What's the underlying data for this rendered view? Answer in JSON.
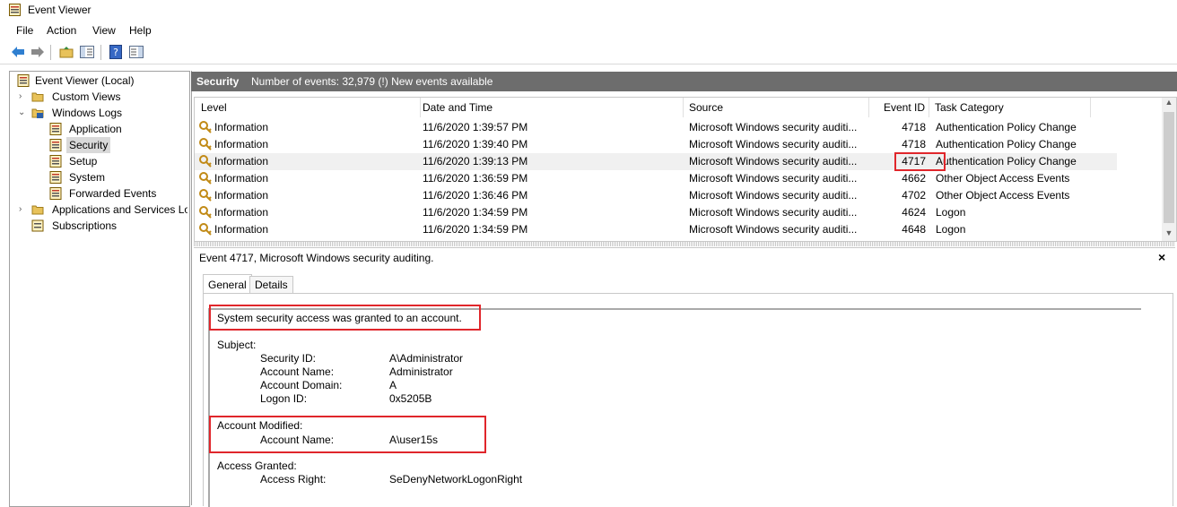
{
  "window": {
    "title": "Event Viewer"
  },
  "menu": [
    "File",
    "Action",
    "View",
    "Help"
  ],
  "toolbar": {
    "buttons": [
      "back-arrow-icon",
      "forward-arrow-icon",
      "up-folder-icon",
      "show-hide-tree-icon",
      "help-icon",
      "show-hide-action-pane-icon"
    ]
  },
  "tree": {
    "root": "Event Viewer (Local)",
    "custom_views": "Custom Views",
    "windows_logs": "Windows Logs",
    "application": "Application",
    "security": "Security",
    "setup": "Setup",
    "system": "System",
    "forwarded": "Forwarded Events",
    "apps_services": "Applications and Services Lo",
    "subscriptions": "Subscriptions"
  },
  "log_header": {
    "title": "Security",
    "summary": "Number of events: 32,979 (!) New events available"
  },
  "columns": {
    "level": "Level",
    "date": "Date and Time",
    "source": "Source",
    "event_id": "Event ID",
    "task": "Task Category"
  },
  "events": [
    {
      "level": "Information",
      "date": "11/6/2020 1:39:57 PM",
      "source": "Microsoft Windows security auditi...",
      "event_id": "4718",
      "task": "Authentication Policy Change"
    },
    {
      "level": "Information",
      "date": "11/6/2020 1:39:40 PM",
      "source": "Microsoft Windows security auditi...",
      "event_id": "4718",
      "task": "Authentication Policy Change"
    },
    {
      "level": "Information",
      "date": "11/6/2020 1:39:13 PM",
      "source": "Microsoft Windows security auditi...",
      "event_id": "4717",
      "task": "Authentication Policy Change"
    },
    {
      "level": "Information",
      "date": "11/6/2020 1:36:59 PM",
      "source": "Microsoft Windows security auditi...",
      "event_id": "4662",
      "task": "Other Object Access Events"
    },
    {
      "level": "Information",
      "date": "11/6/2020 1:36:46 PM",
      "source": "Microsoft Windows security auditi...",
      "event_id": "4702",
      "task": "Other Object Access Events"
    },
    {
      "level": "Information",
      "date": "11/6/2020 1:34:59 PM",
      "source": "Microsoft Windows security auditi...",
      "event_id": "4624",
      "task": "Logon"
    },
    {
      "level": "Information",
      "date": "11/6/2020 1:34:59 PM",
      "source": "Microsoft Windows security auditi...",
      "event_id": "4648",
      "task": "Logon"
    }
  ],
  "detail": {
    "title": "Event 4717, Microsoft Windows security auditing.",
    "close": "×",
    "tabs": {
      "general": "General",
      "details": "Details"
    },
    "message": "System security access was granted to an account.",
    "subject": {
      "heading": "Subject:",
      "security_id_label": "Security ID:",
      "security_id": "A\\Administrator",
      "account_name_label": "Account Name:",
      "account_name": "Administrator",
      "account_domain_label": "Account Domain:",
      "account_domain": "A",
      "logon_id_label": "Logon ID:",
      "logon_id": "0x5205B"
    },
    "account_modified": {
      "heading": "Account Modified:",
      "account_name_label": "Account Name:",
      "account_name": "A\\user15s"
    },
    "access_granted": {
      "heading": "Access Granted:",
      "access_right_label": "Access Right:",
      "access_right": "SeDenyNetworkLogonRight"
    }
  },
  "colors": {
    "header_bar": "#6d6d6d",
    "highlight": "#e0262b",
    "selected_row": "#f0f0f0"
  }
}
